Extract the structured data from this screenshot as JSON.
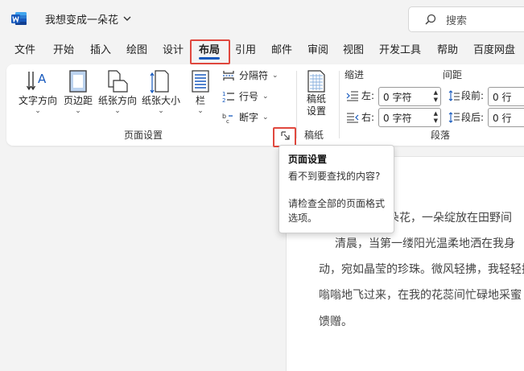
{
  "titlebar": {
    "app_icon": "word-logo",
    "doc_title": "我想变成一朵花",
    "search_placeholder": "搜索"
  },
  "tabs": [
    {
      "label": "文件"
    },
    {
      "label": "开始"
    },
    {
      "label": "插入"
    },
    {
      "label": "绘图"
    },
    {
      "label": "设计"
    },
    {
      "label": "布局",
      "active": true
    },
    {
      "label": "引用"
    },
    {
      "label": "邮件"
    },
    {
      "label": "审阅"
    },
    {
      "label": "视图"
    },
    {
      "label": "开发工具"
    },
    {
      "label": "帮助"
    },
    {
      "label": "百度网盘"
    }
  ],
  "ribbon": {
    "page_setup": {
      "text_direction": "文字方向",
      "margins": "页边距",
      "orientation": "纸张方向",
      "size": "纸张大小",
      "columns": "栏",
      "breaks": "分隔符",
      "line_numbers": "行号",
      "hyphenation": "断字",
      "group_label": "页面设置"
    },
    "manuscript": {
      "button": "稿纸\n设置",
      "group_label": "稿纸"
    },
    "paragraph": {
      "indent_header": "缩进",
      "spacing_header": "间距",
      "left_label": "左:",
      "left_value": "0 字符",
      "right_label": "右:",
      "right_value": "0 字符",
      "before_label": "段前:",
      "before_value": "0 行",
      "after_label": "段后:",
      "after_value": "0 行",
      "group_label": "段落"
    }
  },
  "tooltip": {
    "title": "页面设置",
    "line1": "看不到要查找的内容?",
    "line2": "请检查全部的页面格式选项。"
  },
  "document": {
    "lines": [
      "朵花，一朵绽放在田野间",
      "清晨，当第一缕阳光温柔地洒在我身",
      "动，宛如晶莹的珍珠。微风轻拂，我轻轻摇",
      "嗡嗡地飞过来，在我的花蕊间忙碌地采蜜",
      "馈赠。"
    ]
  },
  "colors": {
    "accent": "#185abd",
    "highlight": "#e0483e",
    "word_blue": "#185abd"
  }
}
